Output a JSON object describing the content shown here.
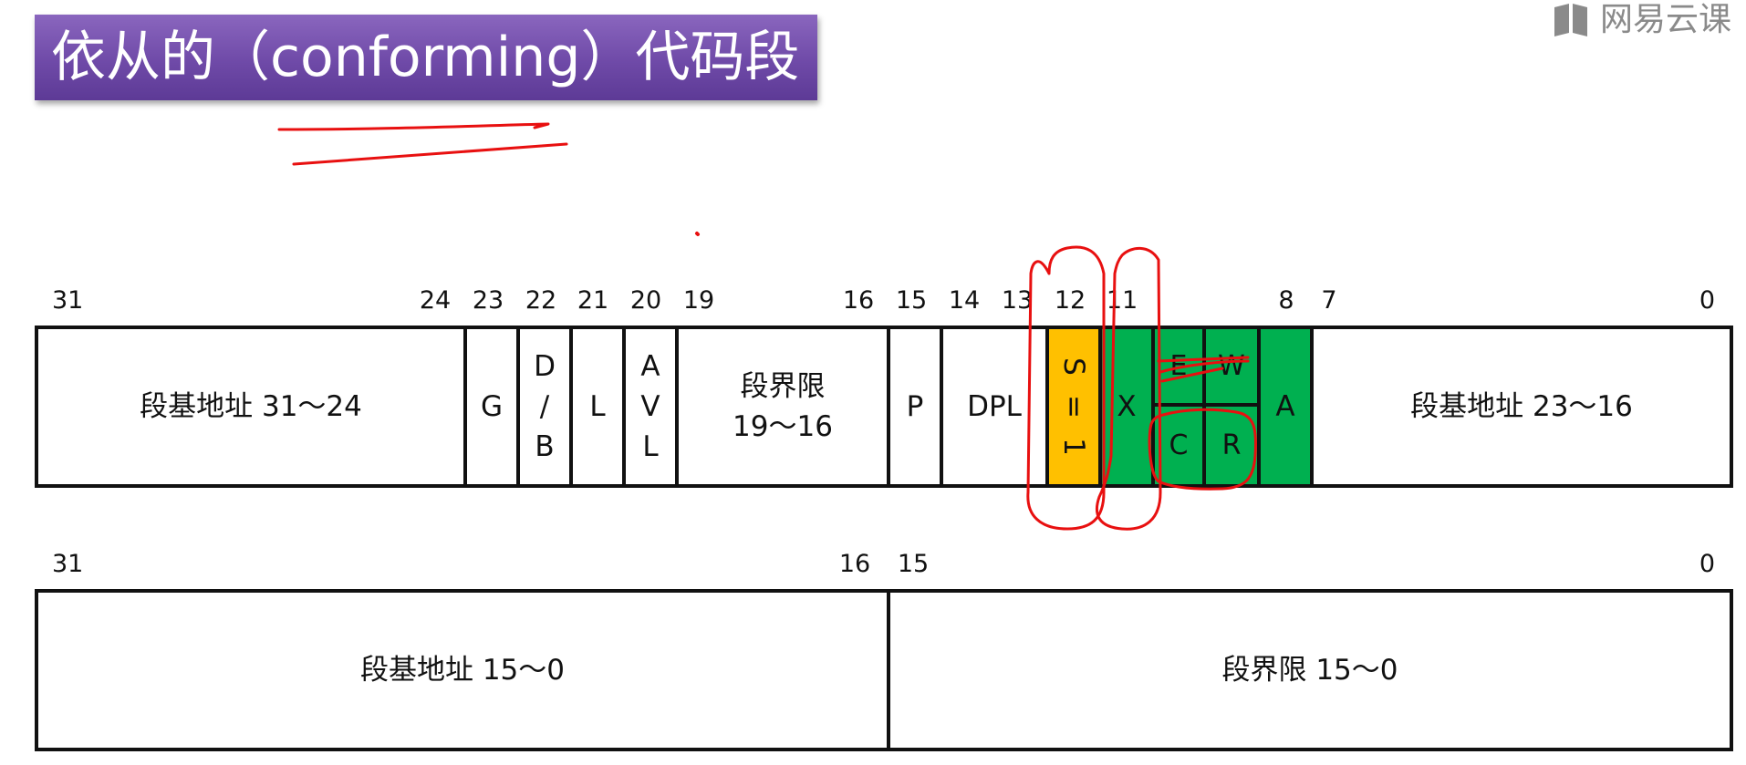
{
  "title": "依从的（conforming）代码段",
  "watermark": "网易云课",
  "row1": {
    "bit_labels": [
      "31",
      "24",
      "23",
      "22",
      "21",
      "20",
      "19",
      "16",
      "15",
      "14",
      "13",
      "12",
      "11",
      "8",
      "7",
      "0"
    ],
    "fields": {
      "base_high": "段基地址 31～24",
      "g": "G",
      "db": [
        "D",
        "/",
        "B"
      ],
      "l": "L",
      "avl": [
        "A",
        "V",
        "L"
      ],
      "limit_high": [
        "段界限",
        "19～16"
      ],
      "p": "P",
      "dpl": "DPL",
      "s": [
        "S",
        "=",
        "1"
      ],
      "x": "X",
      "e": "E",
      "w": "W",
      "c": "C",
      "r": "R",
      "a": "A",
      "base_mid": "段基地址 23～16"
    }
  },
  "row2": {
    "bit_labels": [
      "31",
      "16",
      "15",
      "0"
    ],
    "fields": {
      "base_low": "段基地址 15～0",
      "limit_low": "段界限 15～0"
    }
  },
  "colors": {
    "banner": "#7150aa",
    "type_bits": "#00b050",
    "s_bit": "#ffc000",
    "annotation": "#e81010"
  }
}
